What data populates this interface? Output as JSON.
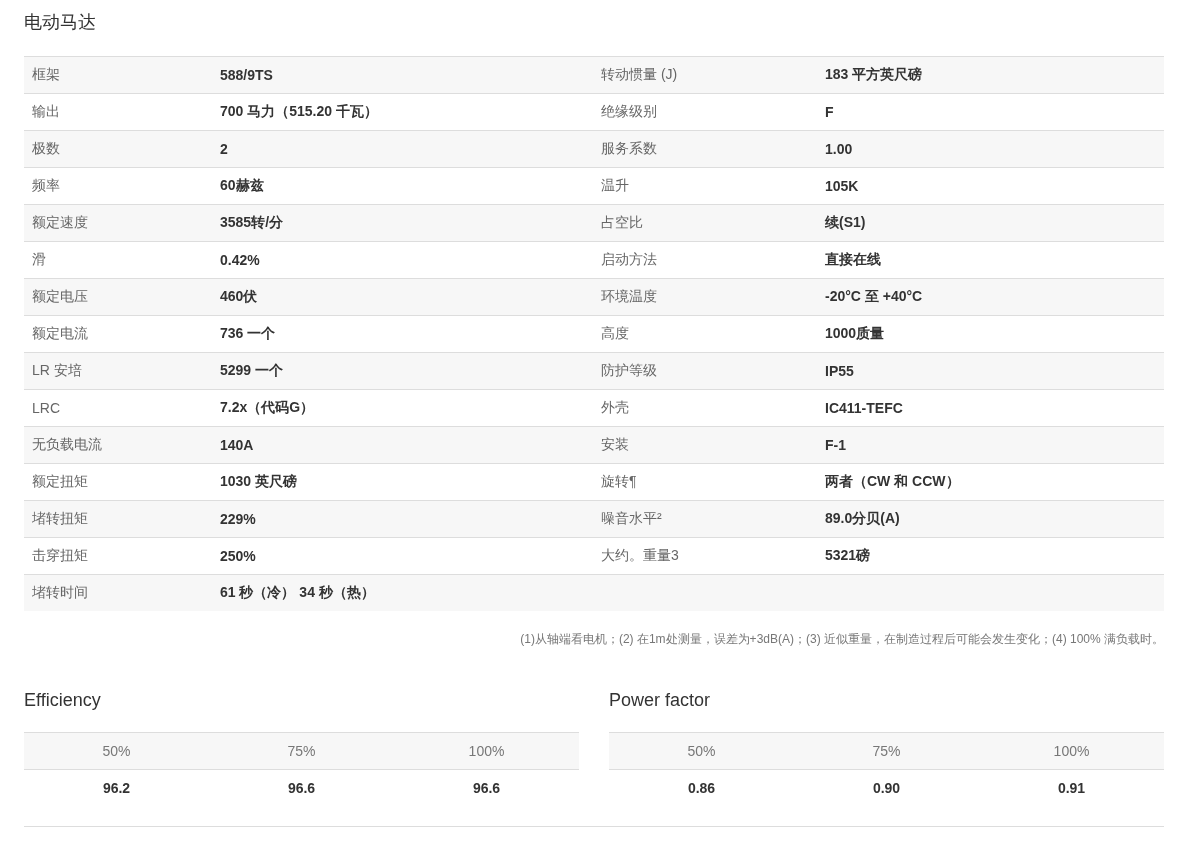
{
  "title": "电动马达",
  "specs": [
    {
      "label": "框架",
      "value": "588/9TS",
      "label_2": "转动惯量 (J)",
      "value_2": "183 平方英尺磅"
    },
    {
      "label": "输出",
      "value": "700 马力（515.20 千瓦）",
      "label_2": "绝缘级别",
      "value_2": "F"
    },
    {
      "label": "极数",
      "value": "2",
      "label_2": "服务系数",
      "value_2": "1.00"
    },
    {
      "label": "频率",
      "value": "60赫兹",
      "label_2": "温升",
      "value_2": "105K"
    },
    {
      "label": "额定速度",
      "value": "3585转/分",
      "label_2": "占空比",
      "value_2": "续(S1)"
    },
    {
      "label": "滑",
      "value": "0.42%",
      "label_2": "启动方法",
      "value_2": "直接在线"
    },
    {
      "label": "额定电压",
      "value": "460伏",
      "label_2": "环境温度",
      "value_2": "-20°C 至 +40°C"
    },
    {
      "label": "额定电流",
      "value": "736 一个",
      "label_2": "高度",
      "value_2": "1000质量"
    },
    {
      "label": "LR 安培",
      "value": "5299 一个",
      "label_2": "防护等级",
      "value_2": "IP55"
    },
    {
      "label": "LRC",
      "value": "7.2x（代码G）",
      "label_2": "外壳",
      "value_2": "IC411-TEFC"
    },
    {
      "label": "无负载电流",
      "value": "140A",
      "label_2": "安装",
      "value_2": "F-1"
    },
    {
      "label": "额定扭矩",
      "value": "1030 英尺磅",
      "label_2": "旋转¶",
      "value_2": "两者（CW 和 CCW）"
    },
    {
      "label": "堵转扭矩",
      "value": "229%",
      "label_2": "噪音水平²",
      "value_2": "89.0分贝(A)"
    },
    {
      "label": "击穿扭矩",
      "value": "250%",
      "label_2": "大约。重量3",
      "value_2": "5321磅"
    },
    {
      "label": "堵转时间",
      "value": "61 秒（冷） 34 秒（热）"
    }
  ],
  "footnote": "(1)从轴端看电机；(2) 在1m处测量，误差为+3dB(A)；(3) 近似重量，在制造过程后可能会发生变化；(4) 100% 满负载时。",
  "load_tables": [
    {
      "title": "Efficiency",
      "columns": [
        "50%",
        "75%",
        "100%"
      ],
      "values": [
        "96.2",
        "96.6",
        "96.6"
      ]
    },
    {
      "title": "Power factor",
      "columns": [
        "50%",
        "75%",
        "100%"
      ],
      "values": [
        "0.86",
        "0.90",
        "0.91"
      ]
    }
  ]
}
